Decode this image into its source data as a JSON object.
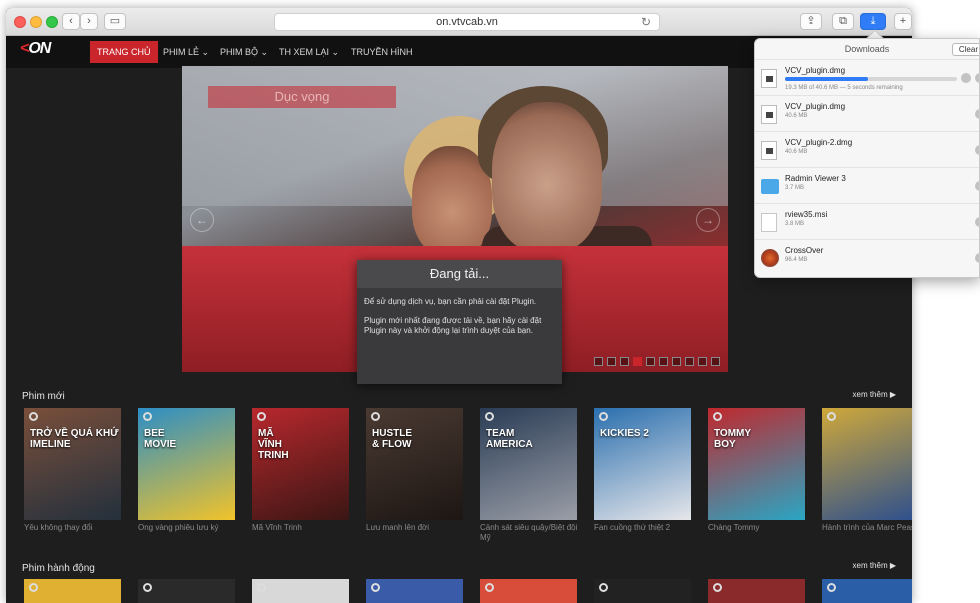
{
  "browser": {
    "url": "on.vtvcab.vn"
  },
  "site": {
    "logo_text": "ON",
    "nav": [
      {
        "label": "TRANG CHỦ"
      },
      {
        "label": "PHIM LẺ ⌄"
      },
      {
        "label": "PHIM BỘ ⌄"
      },
      {
        "label": "TH XEM LẠI ⌄"
      },
      {
        "label": "TRUYỀN HÌNH"
      }
    ],
    "hero": {
      "title": "Dục vọng",
      "prev_arrow": "←",
      "next_arrow": "→",
      "slide_count": 10,
      "active_slide": 3
    },
    "modal": {
      "title": "Đang tải...",
      "paragraph1": "Để sử dụng dịch vụ, bạn cần phải cài đặt Plugin.",
      "paragraph2": "Plugin mới nhất đang được tải về, bạn hãy cài đặt Plugin này và khởi động lại trình duyệt của bạn."
    },
    "row1": {
      "title": "Phim mới",
      "see_more": "xem thêm ▶",
      "posters": [
        {
          "label": "Yêu không thay đổi",
          "art": "TRỞ VỀ QUÁ KHỨ\nIMELINE",
          "color1": "#7a4f3b",
          "color2": "#23303c"
        },
        {
          "label": "Ong vàng phiêu lưu ký",
          "art": "BEE\nMOVIE",
          "color1": "#2c8ec6",
          "color2": "#f1c32a"
        },
        {
          "label": "Mã Vĩnh Trinh",
          "art": "MÃ\nVĨNH\nTRINH",
          "color1": "#b8282d",
          "color2": "#3a1614"
        },
        {
          "label": "Lưu manh lên đời",
          "art": "HUSTLE\n& FLOW",
          "color1": "#4a3a32",
          "color2": "#1d1613"
        },
        {
          "label": "Cảnh sát siêu quậy/Biệt đội Mỹ",
          "art": "TEAM\nAMERICA",
          "color1": "#2a3c55",
          "color2": "#9a9ea7"
        },
        {
          "label": "Fan cuồng thứ thiệt 2",
          "art": "KICKIES 2",
          "color1": "#2a6fae",
          "color2": "#e6e6ea"
        },
        {
          "label": "Chàng Tommy",
          "art": "TOMMY\nBOY",
          "color1": "#c0282d",
          "color2": "#2aa6c4"
        },
        {
          "label": "Hành trình của Marc Pease",
          "art": "",
          "color1": "#cfa83a",
          "color2": "#2c4f8e"
        }
      ]
    },
    "row2": {
      "title": "Phim hành động",
      "see_more": "xem thêm ▶",
      "poster_colors": [
        "#e0b032",
        "#2a2a2a",
        "#d8d8d8",
        "#3a5ca8",
        "#d84c3a",
        "#222222",
        "#8a2a2a",
        "#2a5fa8"
      ]
    }
  },
  "downloads": {
    "title": "Downloads",
    "clear_label": "Clear",
    "items": [
      {
        "name": "VCV_plugin.dmg",
        "status": "19.3 MB of 40.6 MB — 5 seconds remaining",
        "progress": 0.48,
        "icon": "disk-image-icon",
        "downloading": true
      },
      {
        "name": "VCV_plugin.dmg",
        "size": "40.6 MB",
        "icon": "disk-image-icon"
      },
      {
        "name": "VCV_plugin-2.dmg",
        "size": "40.6 MB",
        "icon": "disk-image-icon"
      },
      {
        "name": "Radmin Viewer 3",
        "size": "3.7 MB",
        "icon": "folder-icon"
      },
      {
        "name": "rview35.msi",
        "size": "3.8 MB",
        "icon": "file-icon"
      },
      {
        "name": "CrossOver",
        "size": "96.4 MB",
        "icon": "app-icon"
      }
    ]
  }
}
